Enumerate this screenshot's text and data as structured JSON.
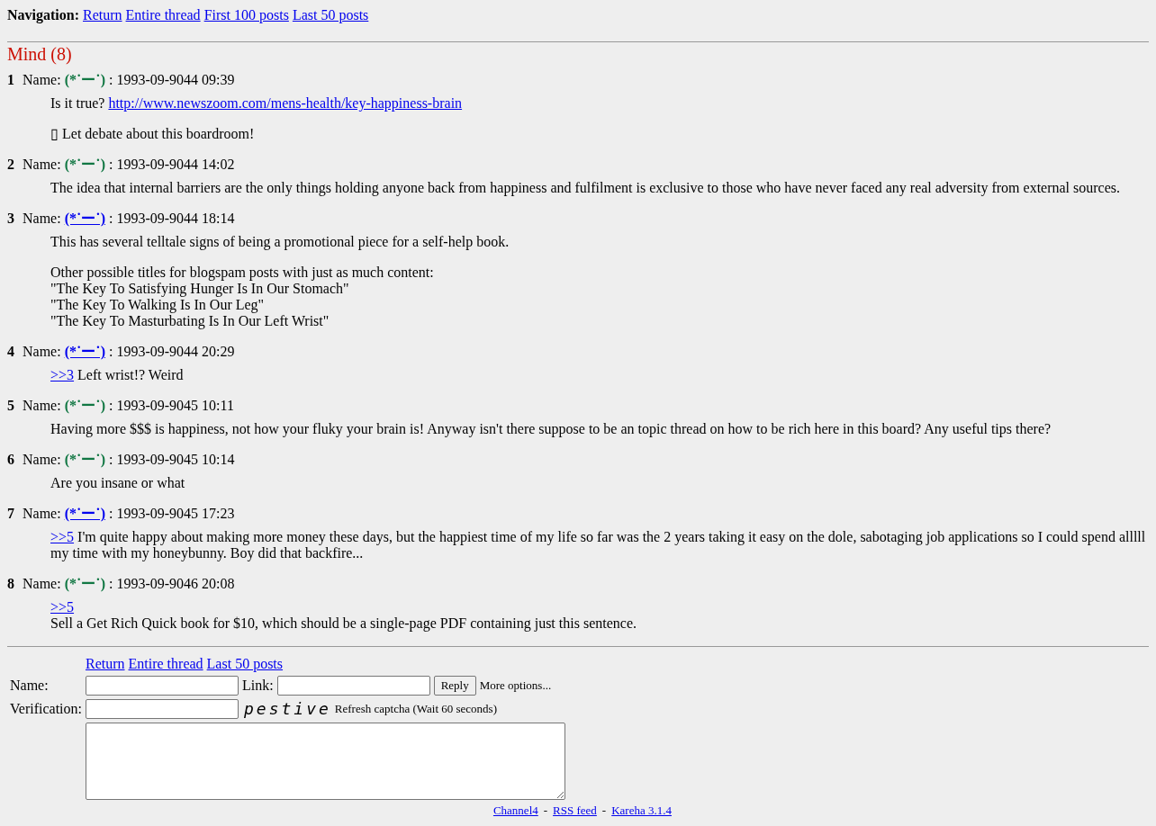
{
  "navigation": {
    "label": "Navigation:",
    "links": [
      "Return",
      "Entire thread",
      "First 100 posts",
      "Last 50 posts"
    ]
  },
  "thread": {
    "title": "Mind (8)"
  },
  "posts": [
    {
      "number": "1",
      "name_label": "Name:",
      "name": "(*˙ー˙)",
      "linked": false,
      "date": ": 1993-09-9044 09:39",
      "paragraphs": [
        [
          [
            {
              "kind": "text",
              "text": "Is it true? "
            },
            {
              "kind": "link",
              "text": "http://www.newszoom.com/mens-health/key-happiness-brain"
            }
          ]
        ],
        [
          [
            {
              "kind": "text",
              "text": "▯ Let debate about this boardroom!"
            }
          ]
        ]
      ]
    },
    {
      "number": "2",
      "name_label": "Name:",
      "name": "(*˙ー˙)",
      "linked": false,
      "date": ": 1993-09-9044 14:02",
      "paragraphs": [
        [
          [
            {
              "kind": "text",
              "text": "The idea that internal barriers are the only things holding anyone back from happiness and fulfilment is exclusive to those who have never faced any real adversity from external sources."
            }
          ]
        ]
      ]
    },
    {
      "number": "3",
      "name_label": "Name:",
      "name": "(*˙ー˙)",
      "linked": true,
      "date": ": 1993-09-9044 18:14",
      "paragraphs": [
        [
          [
            {
              "kind": "text",
              "text": "This has several telltale signs of being a promotional piece for a self-help book."
            }
          ]
        ],
        [
          [
            {
              "kind": "text",
              "text": "Other possible titles for blogspam posts with just as much content:"
            }
          ],
          [
            {
              "kind": "text",
              "text": "\"The Key To Satisfying Hunger Is In Our Stomach\""
            }
          ],
          [
            {
              "kind": "text",
              "text": "\"The Key To Walking Is In Our Leg\""
            }
          ],
          [
            {
              "kind": "text",
              "text": "\"The Key To Masturbating Is In Our Left Wrist\""
            }
          ]
        ]
      ]
    },
    {
      "number": "4",
      "name_label": "Name:",
      "name": "(*˙ー˙)",
      "linked": true,
      "date": ": 1993-09-9044 20:29",
      "paragraphs": [
        [
          [
            {
              "kind": "link",
              "text": ">>3"
            },
            {
              "kind": "text",
              "text": " Left wrist!? Weird"
            }
          ]
        ]
      ]
    },
    {
      "number": "5",
      "name_label": "Name:",
      "name": "(*˙ー˙)",
      "linked": false,
      "date": ": 1993-09-9045 10:11",
      "paragraphs": [
        [
          [
            {
              "kind": "text",
              "text": "Having more $$$ is happiness, not how your fluky your brain is! Anyway isn't there suppose to be an topic thread on how to be rich here in this board? Any useful tips there?"
            }
          ]
        ]
      ]
    },
    {
      "number": "6",
      "name_label": "Name:",
      "name": "(*˙ー˙)",
      "linked": false,
      "date": ": 1993-09-9045 10:14",
      "paragraphs": [
        [
          [
            {
              "kind": "text",
              "text": "Are you insane or what"
            }
          ]
        ]
      ]
    },
    {
      "number": "7",
      "name_label": "Name:",
      "name": "(*˙ー˙)",
      "linked": true,
      "date": ": 1993-09-9045 17:23",
      "paragraphs": [
        [
          [
            {
              "kind": "link",
              "text": ">>5"
            },
            {
              "kind": "text",
              "text": " I'm quite happy about making more money these days, but the happiest time of my life so far was the 2 years taking it easy on the dole, sabotaging job applications so I could spend alllll my time with my honeybunny. Boy did that backfire..."
            }
          ]
        ]
      ]
    },
    {
      "number": "8",
      "name_label": "Name:",
      "name": "(*˙ー˙)",
      "linked": false,
      "date": ": 1993-09-9046 20:08",
      "paragraphs": [
        [
          [
            {
              "kind": "link",
              "text": ">>5"
            }
          ],
          [
            {
              "kind": "text",
              "text": "Sell a Get Rich Quick book for $10, which should be a single-page PDF containing just this sentence."
            }
          ]
        ]
      ]
    }
  ],
  "reply_form": {
    "links": [
      "Return",
      "Entire thread",
      "Last 50 posts"
    ],
    "name_label": "Name:",
    "link_label": "Link:",
    "reply_button": "Reply",
    "more_options": "More options...",
    "verification_label": "Verification:",
    "captcha": "pestive",
    "refresh": "Refresh captcha (Wait 60 seconds)"
  },
  "footer": {
    "links": [
      "Channel4",
      "RSS feed",
      "Kareha 3.1.4"
    ],
    "separator": "-"
  }
}
